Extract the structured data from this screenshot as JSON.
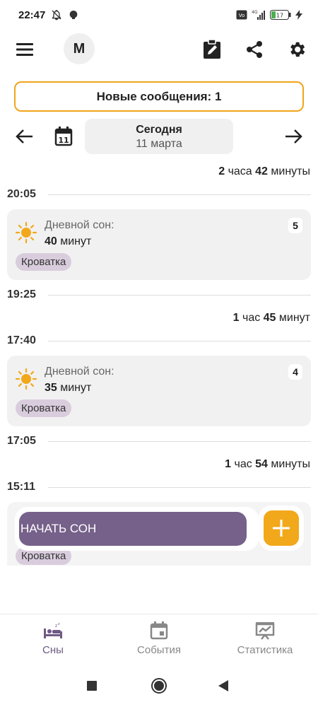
{
  "status_bar": {
    "time": "22:47",
    "battery": "17",
    "icons": [
      "bell-off-icon",
      "notification-icon",
      "volte-icon",
      "signal-4g-icon",
      "battery-icon",
      "charging-icon"
    ]
  },
  "toolbar": {
    "avatar_letter": "M",
    "icons": [
      "menu-icon",
      "edit-note-icon",
      "share-icon",
      "settings-icon"
    ]
  },
  "banner": {
    "text": "Новые сообщения: 1",
    "color": "#f0a51a"
  },
  "date_nav": {
    "title": "Сегодня",
    "date": "11 марта",
    "calendar_day": "11"
  },
  "timeline": {
    "durations": [
      {
        "n1": "2",
        "w1": " часа ",
        "n2": "42",
        "w2": " минуты"
      },
      {
        "n1": "1",
        "w1": " час ",
        "n2": "45",
        "w2": " минут"
      },
      {
        "n1": "1",
        "w1": " час ",
        "n2": "54",
        "w2": " минуты"
      }
    ],
    "times": [
      "20:05",
      "19:25",
      "17:40",
      "17:05",
      "15:11"
    ],
    "cards": [
      {
        "label": "Дневной сон:",
        "value_num": "40",
        "value_unit": " минут",
        "badge": "5",
        "tag": "Кроватка"
      },
      {
        "label": "Дневной сон:",
        "value_num": "35",
        "value_unit": " минут",
        "badge": "4",
        "tag": "Кроватка"
      }
    ],
    "partial_tag": "Кроватка"
  },
  "actions": {
    "start_sleep": "НАЧАТЬ СОН",
    "primary_color": "#76618a",
    "accent_color": "#f2a81b"
  },
  "bottom_nav": {
    "items": [
      {
        "label": "Сны",
        "icon": "bed-icon",
        "active": true
      },
      {
        "label": "События",
        "icon": "calendar-icon",
        "active": false
      },
      {
        "label": "Статистика",
        "icon": "chart-icon",
        "active": false
      }
    ]
  }
}
